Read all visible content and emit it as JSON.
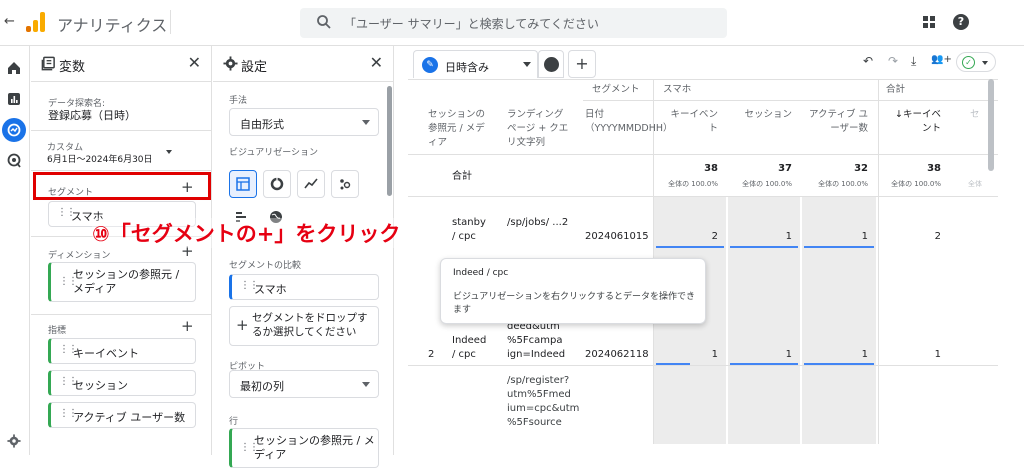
{
  "header": {
    "back_glyph": "←",
    "app_title": "アナリティクス",
    "search_placeholder": "「ユーザー サマリー」と検索してみてください",
    "help_glyph": "?",
    "logo_colors": [
      "#f9ab00",
      "#e37400",
      "#e37400"
    ]
  },
  "rail": {
    "icons": [
      "home-icon",
      "reports-icon",
      "explore-icon",
      "advertising-icon",
      "admin-settings-icon"
    ]
  },
  "variables_panel": {
    "title": "変数",
    "close": "✕",
    "exploration_name_label": "データ探索名:",
    "exploration_name": "登録応募（日時）",
    "date_label": "カスタム",
    "date_range": "6月1日～2024年6月30日",
    "segments_label": "セグメント",
    "segments": [
      "スマホ"
    ],
    "dimensions_label": "ディメンション",
    "dimensions": [
      "セッションの参照元 / メディア"
    ],
    "metrics_label": "指標",
    "metrics": [
      "キーイベント",
      "セッション",
      "アクティブ ユーザー数"
    ],
    "plus": "+"
  },
  "settings_panel": {
    "title": "設定",
    "close": "✕",
    "technique_label": "手法",
    "technique_value": "自由形式",
    "visualization_label": "ビジュアリゼーション",
    "segment_compare_label": "セグメントの比較",
    "segment_compare_item": "スマホ",
    "drop_hint": "セグメントをドロップするか選択してください",
    "pivot_label": "ピボット",
    "pivot_value": "最初の列",
    "rows_label": "行",
    "rows_item": "セッションの参照元 / メディア",
    "plus": "+"
  },
  "annotation": {
    "callout": "⑩「セグメントの+」をクリック",
    "accent_color": "#e60012"
  },
  "report": {
    "tab_label": "日時含み",
    "add_tab": "+",
    "tools": [
      "↶",
      "↷",
      "⤓",
      "👥+"
    ],
    "ok_glyph": "✓",
    "columns": {
      "segment_group": "セグメント",
      "segment_name": "スマホ",
      "total_group": "合計",
      "source": "セッションの参照元 / メディア",
      "landing": "ランディング ページ + クエリ文字列",
      "date": "日付（YYYYMMDDHH）",
      "key_events": "キーイベント",
      "sessions": "セッション",
      "active_users": "アクティブ ユーザー数",
      "total_key_events": "↓キーイベント",
      "total_sessions_partial": "セ"
    },
    "totals": {
      "label": "合計",
      "key_events": "38",
      "sessions": "37",
      "active_users": "32",
      "total_key_events": "38",
      "pct": "全体の 100.0%",
      "pct_partial": "全体"
    },
    "rows": [
      {
        "index": "",
        "source": "stanby / cpc",
        "landing": "/sp/jobs/ ...2",
        "date": "2024061015",
        "key_events": "2",
        "sessions": "1",
        "active_users": "1",
        "total_key_events": "2"
      },
      {
        "index": "2",
        "source": "Indeed / cpc",
        "landing": "deed&utm %5Fcampa ign=Indeed",
        "date": "2024062118",
        "key_events": "1",
        "sessions": "1",
        "active_users": "1",
        "total_key_events": "1"
      },
      {
        "index": "",
        "source": "",
        "landing": "/sp/register? utm%5Fmed ium=cpc&utm %5Fsource",
        "date": "",
        "key_events": "",
        "sessions": "",
        "active_users": "",
        "total_key_events": ""
      }
    ],
    "tooltip": {
      "title": "Indeed / cpc",
      "body": "ビジュアリゼーションを右クリックするとデータを操作できます"
    }
  }
}
